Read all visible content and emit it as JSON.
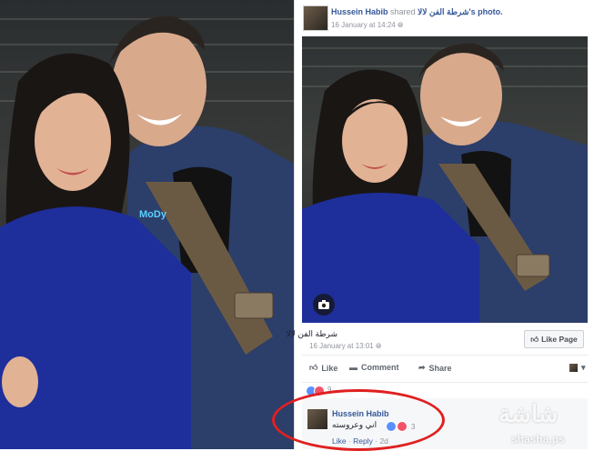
{
  "left_photo": {
    "watermark": "MoDy"
  },
  "post": {
    "author": "Hussein Habib",
    "shared_word": "shared",
    "page_name": "شرطة الفن لالا",
    "page_suffix": "'s photo.",
    "timestamp": "16 January at 14:24",
    "visibility_icon": "globe-icon"
  },
  "page_card": {
    "page_name": "شرطة الفن لالا",
    "timestamp": "16 January at 13:01",
    "like_page_label": "Like Page"
  },
  "actions": {
    "like_label": "Like",
    "comment_label": "Comment",
    "share_label": "Share"
  },
  "reactions": {
    "count": "9"
  },
  "comment": {
    "author": "Hussein Habib",
    "text": "اني وعروسته",
    "reaction_count": "3",
    "like_label": "Like",
    "reply_label": "Reply",
    "age": "2d"
  },
  "watermark": {
    "logo": "شاشة",
    "url": "shasha.ps"
  },
  "colors": {
    "link": "#365899",
    "meta": "#90949c",
    "highlight_ellipse": "#e02020",
    "jacket_blue": "#1e2f9b"
  }
}
